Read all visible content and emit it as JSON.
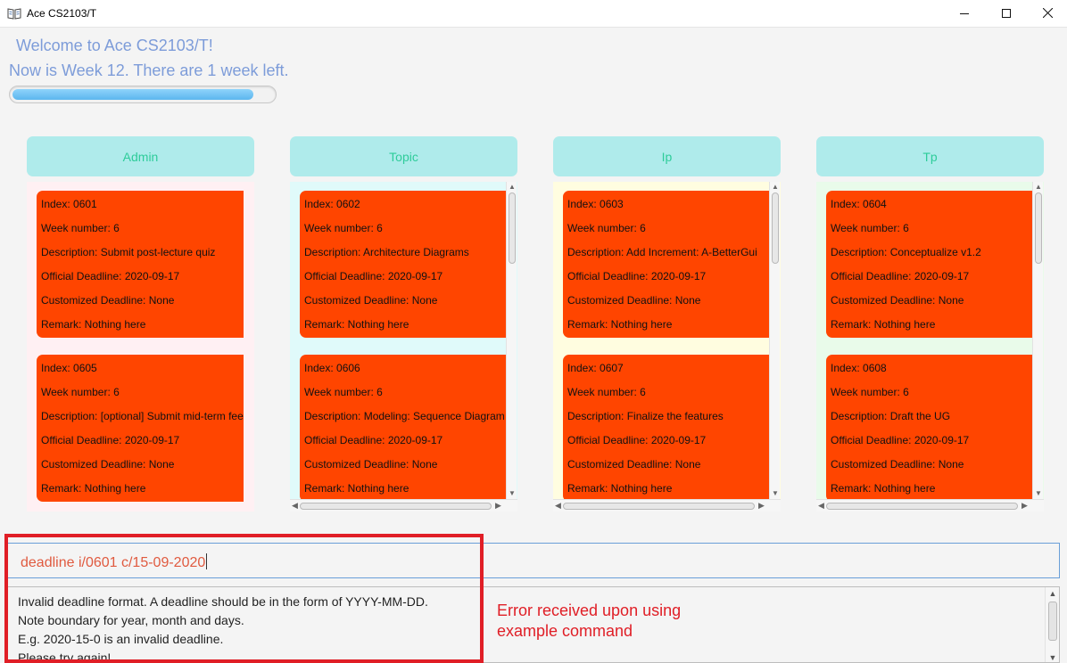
{
  "window": {
    "title": "Ace CS2103/T",
    "icon": "book-icon",
    "controls": {
      "minimize": "–",
      "maximize": "☐",
      "close": "✕"
    }
  },
  "header": {
    "welcome": "Welcome to Ace CS2103/T!",
    "week_status": "Now is Week 12. There are 1 week left.",
    "progress_fraction": 0.92
  },
  "columns": [
    {
      "title": "Admin",
      "bg_color": "#fff0f3",
      "cards": [
        {
          "index": "Index: 0601",
          "week": "Week number: 6",
          "description": "Description: Submit post-lecture quiz",
          "official": "Official Deadline: 2020-09-17",
          "customized": "Customized Deadline: None",
          "remark": "Remark: Nothing here"
        },
        {
          "index": "Index: 0605",
          "week": "Week number: 6",
          "description": "Description: [optional] Submit mid-term feed",
          "official": "Official Deadline: 2020-09-17",
          "customized": "Customized Deadline: None",
          "remark": "Remark: Nothing here"
        }
      ]
    },
    {
      "title": "Topic",
      "bg_color": "#e0fafa",
      "cards": [
        {
          "index": "Index: 0602",
          "week": "Week number: 6",
          "description": "Description: Architecture Diagrams",
          "official": "Official Deadline: 2020-09-17",
          "customized": "Customized Deadline: None",
          "remark": "Remark: Nothing here"
        },
        {
          "index": "Index: 0606",
          "week": "Week number: 6",
          "description": "Description: Modeling: Sequence Diagram",
          "official": "Official Deadline: 2020-09-17",
          "customized": "Customized Deadline: None",
          "remark": "Remark: Nothing here"
        }
      ]
    },
    {
      "title": "Ip",
      "bg_color": "#fffde0",
      "cards": [
        {
          "index": "Index: 0603",
          "week": "Week number: 6",
          "description": "Description: Add Increment: A-BetterGui",
          "official": "Official Deadline: 2020-09-17",
          "customized": "Customized Deadline: None",
          "remark": "Remark: Nothing here"
        },
        {
          "index": "Index: 0607",
          "week": "Week number: 6",
          "description": "Description: Finalize the features",
          "official": "Official Deadline: 2020-09-17",
          "customized": "Customized Deadline: None",
          "remark": "Remark: Nothing here"
        }
      ]
    },
    {
      "title": "Tp",
      "bg_color": "#e9fbea",
      "cards": [
        {
          "index": "Index: 0604",
          "week": "Week number: 6",
          "description": "Description: Conceptualize v1.2",
          "official": "Official Deadline: 2020-09-17",
          "customized": "Customized Deadline: None",
          "remark": "Remark: Nothing here"
        },
        {
          "index": "Index: 0608",
          "week": "Week number: 6",
          "description": "Description: Draft the UG",
          "official": "Official Deadline: 2020-09-17",
          "customized": "Customized Deadline: None",
          "remark": "Remark: Nothing here"
        }
      ]
    }
  ],
  "command": {
    "value": "deadline i/0601 c/15-09-2020"
  },
  "result": {
    "lines": [
      "Invalid deadline format. A deadline should be in the form of YYYY-MM-DD.",
      "Note boundary for year, month and days.",
      "E.g. 2020-15-0 is an invalid deadline.",
      "Please try again!"
    ]
  },
  "annotation": {
    "line1": "Error received upon using",
    "line2": "example command",
    "color": "#e01e26"
  },
  "colors": {
    "card": "#ff4500",
    "header_bg": "#afebeb",
    "header_text": "#2ecc9a",
    "welcome_text": "#7d9cd9",
    "command_text": "#e05a3f"
  }
}
